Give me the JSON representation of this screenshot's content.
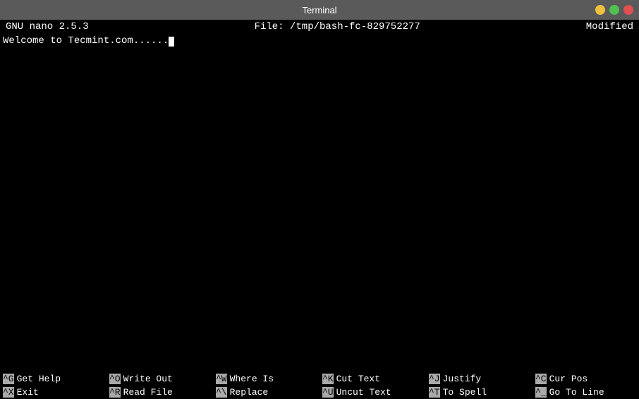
{
  "titleBar": {
    "title": "Terminal"
  },
  "nanoHeader": {
    "left": "GNU nano 2.5.3",
    "center": "File: /tmp/bash-fc-829752277",
    "right": "Modified"
  },
  "editorContent": "Welcome to Tecmint.com......",
  "shortcuts": [
    {
      "key": "^G",
      "label": "Get Help"
    },
    {
      "key": "^O",
      "label": "Write Out"
    },
    {
      "key": "^W",
      "label": "Where Is"
    },
    {
      "key": "^X",
      "label": "Exit"
    },
    {
      "key": "^R",
      "label": "Read File"
    },
    {
      "key": "^\\",
      "label": "Replace"
    },
    {
      "key": "^K",
      "label": "Cut Text"
    },
    {
      "key": "^J",
      "label": "Justify"
    },
    {
      "key": "^C",
      "label": "Cur Pos"
    },
    {
      "key": "^U",
      "label": "Uncut Text"
    },
    {
      "key": "^T",
      "label": "To Spell"
    },
    {
      "key": "^_",
      "label": "Go To Line"
    }
  ]
}
